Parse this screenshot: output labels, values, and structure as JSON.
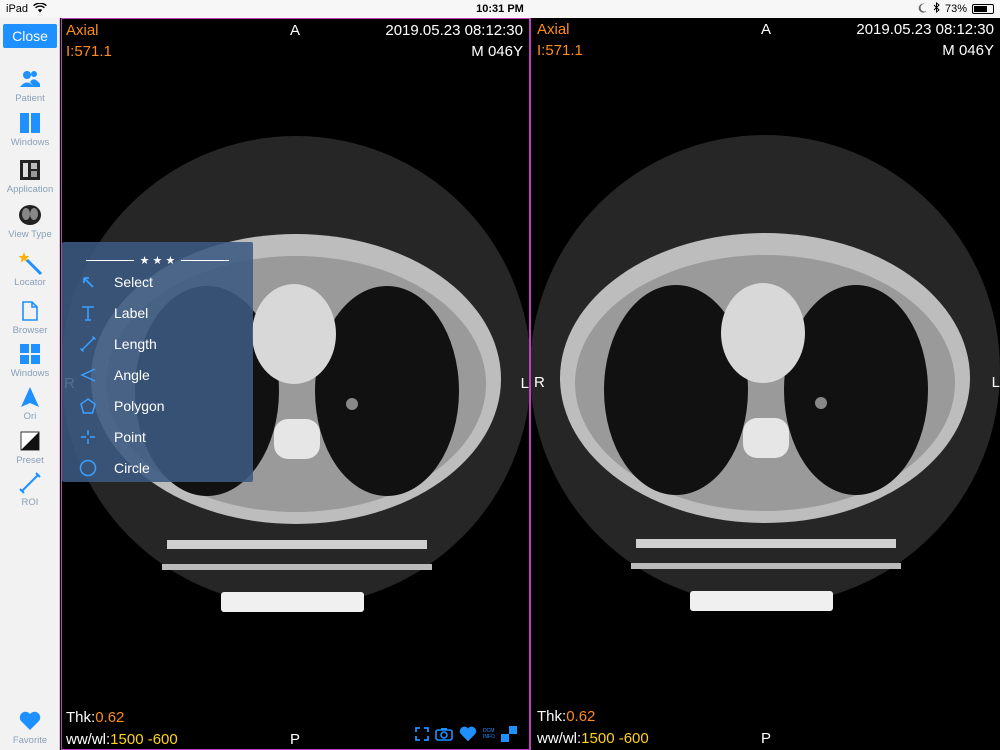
{
  "status_bar": {
    "device": "iPad",
    "time": "10:31 PM",
    "battery": "73%",
    "battery_level": 0.73
  },
  "sidebar": {
    "close_label": "Close",
    "items": [
      {
        "label": "Patient",
        "icon": "patient-icon"
      },
      {
        "label": "Windows",
        "icon": "windows-layout-icon"
      },
      {
        "label": "Application",
        "icon": "application-icon"
      },
      {
        "label": "View Type",
        "icon": "view-type-icon"
      },
      {
        "label": "Locator",
        "icon": "locator-icon"
      },
      {
        "label": "Browser",
        "icon": "browser-icon"
      },
      {
        "label": "Windows",
        "icon": "windows-grid-icon"
      },
      {
        "label": "Ori",
        "icon": "orientation-icon"
      },
      {
        "label": "Preset",
        "icon": "preset-icon"
      },
      {
        "label": "ROI",
        "icon": "roi-icon"
      }
    ],
    "favorite_label": "Favorite"
  },
  "viewports": [
    {
      "plane": "Axial",
      "image_index": "I:571.1",
      "top_marker": "A",
      "datetime": "2019.05.23 08:12:30",
      "patient": "M 046Y",
      "left_marker": "R",
      "right_marker": "L",
      "bottom_marker": "P",
      "thk_label": "Thk:",
      "thk_value": "0.62",
      "wwwl_label": "ww/wl:",
      "wwwl_value": "1500 -600"
    },
    {
      "plane": "Axial",
      "image_index": "I:571.1",
      "top_marker": "A",
      "datetime": "2019.05.23 08:12:30",
      "patient": "M 046Y",
      "left_marker": "R",
      "right_marker": "L",
      "bottom_marker": "P",
      "thk_label": "Thk:",
      "thk_value": "0.62",
      "wwwl_label": "ww/wl:",
      "wwwl_value": "1500 -600"
    }
  ],
  "tools_menu": {
    "header": "★ ★ ★",
    "items": [
      {
        "label": "Select",
        "icon": "select-arrow-icon"
      },
      {
        "label": "Label",
        "icon": "text-label-icon"
      },
      {
        "label": "Length",
        "icon": "length-line-icon"
      },
      {
        "label": "Angle",
        "icon": "angle-icon"
      },
      {
        "label": "Polygon",
        "icon": "polygon-icon"
      },
      {
        "label": "Point",
        "icon": "point-crosshair-icon"
      },
      {
        "label": "Circle",
        "icon": "circle-icon"
      }
    ]
  },
  "bottom_toolbar": {
    "icons": [
      "fullscreen-icon",
      "camera-icon",
      "favorite-heart-icon",
      "dicom-info-icon",
      "checker-icon"
    ],
    "dicom_text_top": "DCM",
    "dicom_text_bottom": "INFO"
  },
  "colors": {
    "accent": "#1e90ff",
    "overlay_orange": "#ff8c1a",
    "overlay_yellow": "#ffd21a",
    "viewport_border": "#c040c0",
    "sidebar_icon": "#1e90ff"
  }
}
